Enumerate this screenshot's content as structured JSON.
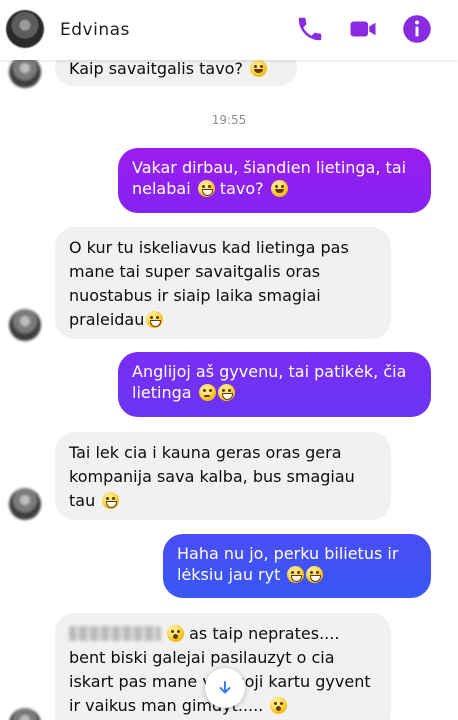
{
  "header": {
    "contact_name": "Edvinas",
    "icons": [
      "phone-icon",
      "video-camera-icon",
      "info-icon"
    ],
    "accent_color": "#8a2be2"
  },
  "chat": {
    "timestamp": "19:55",
    "messages": [
      {
        "from": "them",
        "text": "Kaip savaitgalis tavo?",
        "emoji": "smile"
      },
      {
        "from": "me",
        "text": "Vakar dirbau, šiandien lietinga, tai nelabai",
        "emoji_mid": "grin",
        "text_after": "tavo?",
        "emoji": "smile"
      },
      {
        "from": "them",
        "text": "O kur tu iskeliavus kad lietinga pas mane tai super savaitgalis oras nuostabus ir siaip laika smagiai praleidau",
        "emoji": "grin"
      },
      {
        "from": "me",
        "text": "Anglijoj aš gyvenu, tai patikėk, čia lietinga",
        "emoji": "worried+grin"
      },
      {
        "from": "them",
        "text": "Tai lek cia i kauna geras oras gera kompanija sava kalba, bus smagiau tau",
        "emoji": "grin"
      },
      {
        "from": "me",
        "text": "Haha nu jo, perku bilietus ir lėksiu jau ryt",
        "emoji": "sweat-smile x2"
      },
      {
        "from": "them",
        "text_after_blur": "as taip neprates.... bent biski galejai pasilauzyt o cia iskart pas mane",
        "text_tail": "vaziuoji kartu gyvent ir vaikus man gimdyt.....",
        "emoji": "wow"
      }
    ]
  },
  "colors": {
    "incoming_bubble": "#f1f1f1",
    "outgoing_gradient": [
      "#9b1df0",
      "#7a2cf5",
      "#4a4cf7",
      "#2f63f0"
    ]
  }
}
